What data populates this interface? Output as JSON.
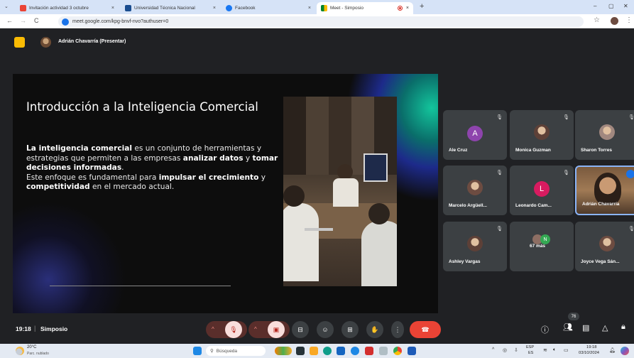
{
  "colors": {
    "accent": "#1a73e8",
    "meet_bg": "#202124",
    "hangup": "#ea4335",
    "tile_bg": "#3c4043",
    "slide_title": "#ffffff"
  },
  "browser": {
    "tabs": [
      {
        "title": "Invitación actividad 3 octubre",
        "close": "×",
        "favicon": "gmail-icon"
      },
      {
        "title": "Universidad Técnica Nacional",
        "close": "×",
        "favicon": "utn-icon"
      },
      {
        "title": "Facebook",
        "close": "×",
        "favicon": "facebook-icon"
      },
      {
        "title": "Meet - Simposio",
        "close": "×",
        "favicon": "meet-icon",
        "active": true
      }
    ],
    "new_tab": "+",
    "url": "meet.google.com/kpg-bnvf-nvo?authuser=0",
    "window_controls": [
      "–",
      "▢",
      "✕"
    ]
  },
  "meet": {
    "presenter_label": "Adrián Chavarría (Presentar)",
    "slide": {
      "title": "Introducción a la Inteligencia Comercial",
      "body": [
        [
          {
            "t": "La inteligencia comercial",
            "b": true
          },
          {
            "t": " es un conjunto de herramientas y estrategias que permiten a las empresas ",
            "b": false
          },
          {
            "t": "analizar datos",
            "b": true
          },
          {
            "t": " y ",
            "b": false
          },
          {
            "t": "tomar decisiones informadas",
            "b": true
          },
          {
            "t": ".",
            "b": false
          }
        ],
        [
          {
            "t": "Este enfoque es fundamental para ",
            "b": false
          },
          {
            "t": "impulsar el crecimiento",
            "b": true
          },
          {
            "t": " y ",
            "b": false
          },
          {
            "t": "competitividad",
            "b": true
          },
          {
            "t": " en el mercado actual.",
            "b": false
          }
        ]
      ]
    },
    "participants": [
      {
        "name": "Ale Cruz",
        "type": "letter",
        "letter": "A",
        "color": "#8e44ad"
      },
      {
        "name": "Monica Guzman",
        "type": "photo"
      },
      {
        "name": "Sharon Torres",
        "type": "photo"
      },
      {
        "name": "Marcelo Argüell...",
        "type": "photo"
      },
      {
        "name": "Leonardo Cam...",
        "type": "letter",
        "letter": "L",
        "color": "#d81b60"
      },
      {
        "name": "Adrián Chavarría",
        "type": "video"
      },
      {
        "name": "Ashley Vargas",
        "type": "photo"
      },
      {
        "name": "67 más",
        "type": "more",
        "letter": "N"
      },
      {
        "name": "Joyce Vega Sán...",
        "type": "photo"
      }
    ],
    "time": "19:18",
    "separator": "|",
    "meeting_name": "Simposio",
    "people_count": "76"
  },
  "taskbar": {
    "weather_temp": "20°C",
    "weather_desc": "Parc. nublado",
    "search_placeholder": "Búsqueda",
    "lang": "ESP",
    "lang2": "ES",
    "clock_time": "19:18",
    "clock_date": "03/10/2024"
  }
}
